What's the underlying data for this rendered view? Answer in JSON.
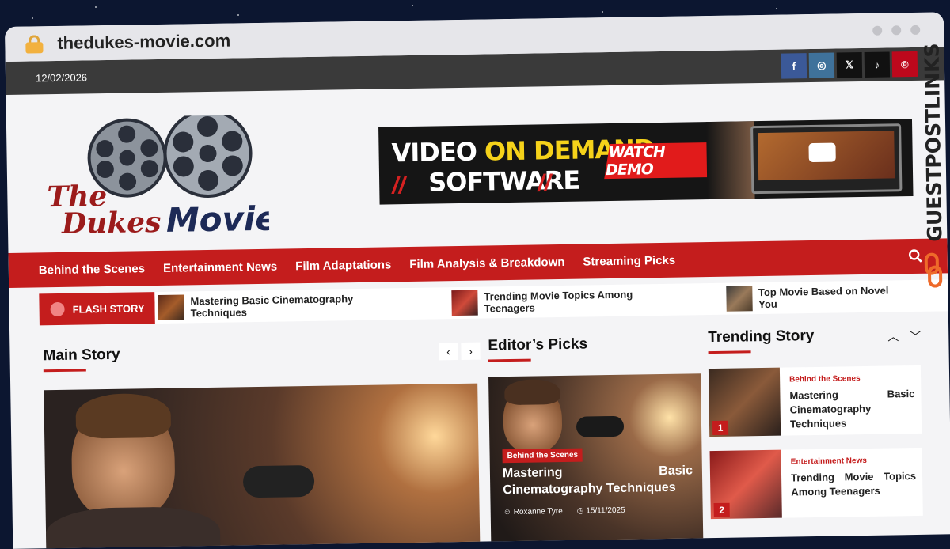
{
  "browser": {
    "url": "thedukes-movie.com"
  },
  "topbar": {
    "date": "12/02/2026",
    "socials": [
      {
        "icon": "facebook-icon",
        "glyph": "f",
        "color": "#3b5998"
      },
      {
        "icon": "instagram-icon",
        "glyph": "◎",
        "color": "#3f729b"
      },
      {
        "icon": "x-icon",
        "glyph": "𝕏",
        "color": "#111111"
      },
      {
        "icon": "tiktok-icon",
        "glyph": "♪",
        "color": "#111111"
      },
      {
        "icon": "pinterest-icon",
        "glyph": "℗",
        "color": "#bd081c"
      }
    ]
  },
  "logo": {
    "line1": "The",
    "line2": "Dukes",
    "line3": "Movie"
  },
  "banner": {
    "line1a": "VIDEO",
    "line1b": "ON DEMAND",
    "line2": "SOFTWARE",
    "cta": "WATCH DEMO"
  },
  "nav": {
    "items": [
      "Behind the Scenes",
      "Entertainment News",
      "Film Adaptations",
      "Film Analysis & Breakdown",
      "Streaming Picks"
    ]
  },
  "flash": {
    "label": "FLASH STORY",
    "items": [
      "Mastering Basic Cinematography Techniques",
      "Trending Movie Topics Among Teenagers",
      "Top Movie Based on Novel You"
    ]
  },
  "main_story": {
    "heading": "Main Story"
  },
  "editors_picks": {
    "heading": "Editor’s Picks",
    "card": {
      "category": "Behind the Scenes",
      "title": "Mastering Basic Cinematography Techniques",
      "author": "Roxanne Tyre",
      "date": "15/11/2025"
    }
  },
  "trending": {
    "heading": "Trending Story",
    "items": [
      {
        "num": "1",
        "category": "Behind the Scenes",
        "title": "Mastering Basic Cinematography Techniques"
      },
      {
        "num": "2",
        "category": "Entertainment News",
        "title": "Trending Movie Topics Among Teenagers"
      }
    ]
  },
  "side_badge": {
    "text": "GUESTPOSTLINKS"
  },
  "colors": {
    "accent": "#c41d1d",
    "topbar": "#3a3a3a",
    "logo_red": "#9b1b1b",
    "logo_navy": "#1d2a57"
  }
}
